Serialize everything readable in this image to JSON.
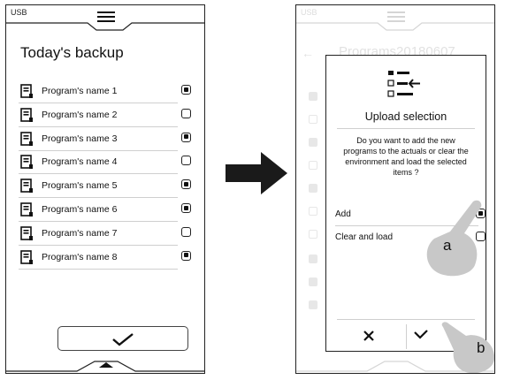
{
  "left_screen": {
    "usb_label": "USB",
    "title": "Today's backup",
    "programs": [
      {
        "name": "Program's name 1",
        "checked": true
      },
      {
        "name": "Program's name 2",
        "checked": false
      },
      {
        "name": "Program's name 3",
        "checked": true
      },
      {
        "name": "Program's name 4",
        "checked": false
      },
      {
        "name": "Program's name 5",
        "checked": true
      },
      {
        "name": "Program's name 6",
        "checked": true
      },
      {
        "name": "Program's name 7",
        "checked": false
      },
      {
        "name": "Program's name 8",
        "checked": true
      }
    ],
    "icons": {
      "menu": "hamburger-menu-icon",
      "file": "program-file-icon",
      "scroll_up": "chevron-up-icon",
      "scroll_down": "chevron-down-icon",
      "confirm": "checkmark-icon",
      "bottom_handle": "triangle-up-icon"
    }
  },
  "transition_arrow": "right-arrow-icon",
  "right_screen": {
    "usb_label": "USB",
    "faded_title": "Programs20180607",
    "modal": {
      "icon": "list-import-icon",
      "title": "Upload selection",
      "message": "Do you want to add the new programs to the actuals or clear the environment and load the selected items ?",
      "options": [
        {
          "label": "Add",
          "checked": true
        },
        {
          "label": "Clear and load",
          "checked": false
        }
      ],
      "cancel_icon": "x-icon",
      "ok_icon": "checkmark-icon"
    },
    "callouts": {
      "a": "a",
      "b": "b"
    }
  },
  "colors": {
    "frame": "#222222",
    "separator": "#cfcfcf",
    "hand": "#c8c8c8",
    "arrow": "#1a1a1a"
  }
}
